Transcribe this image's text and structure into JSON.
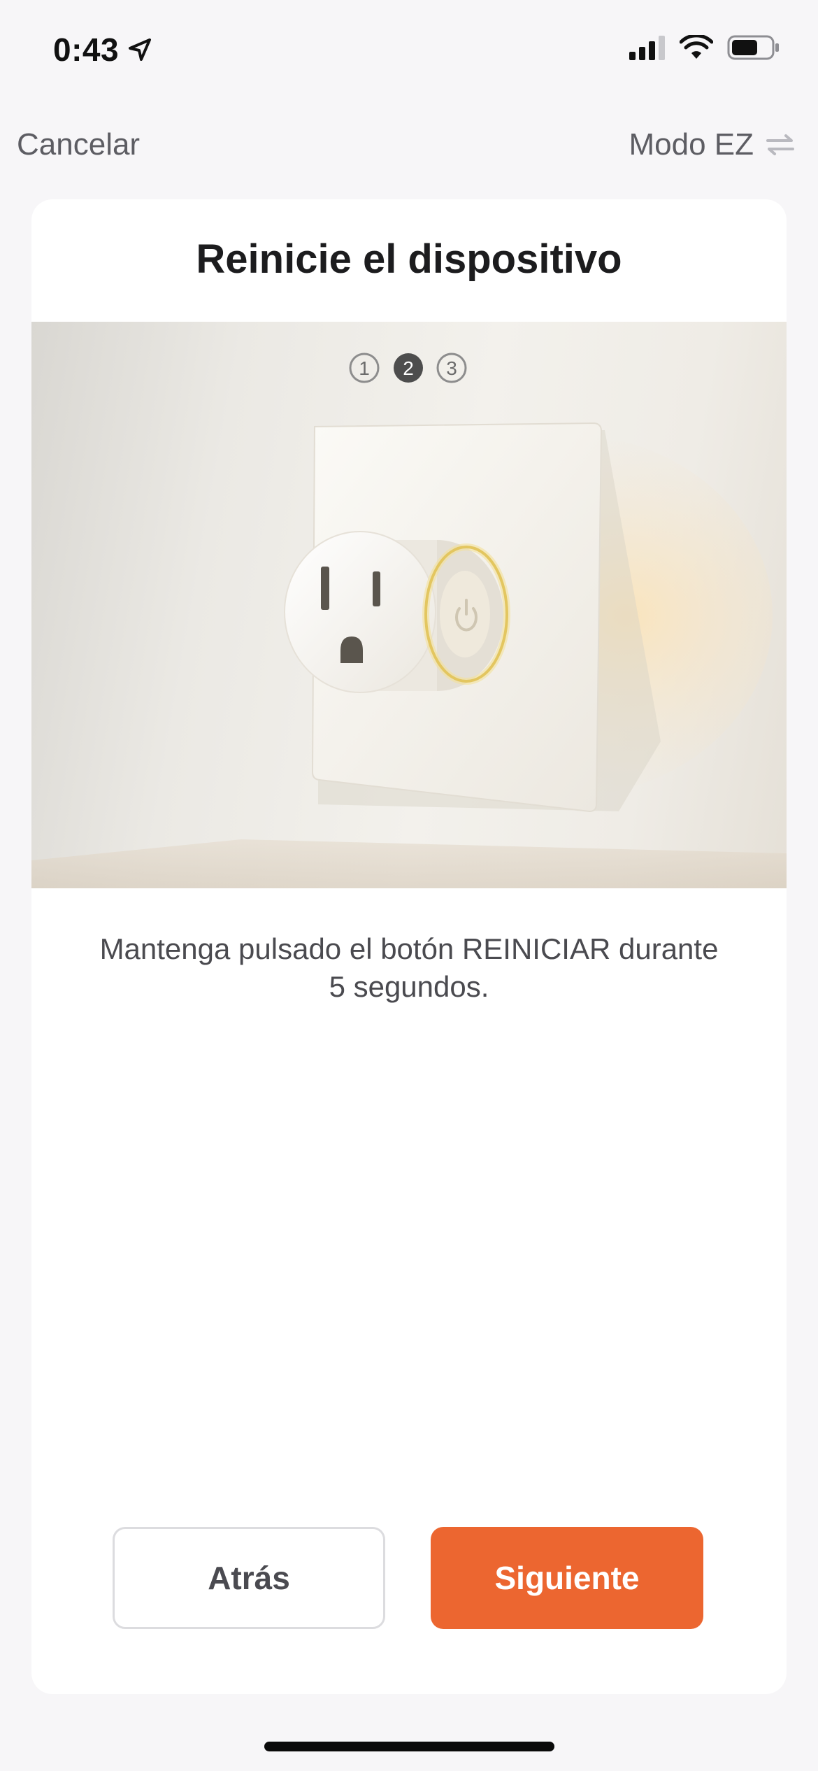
{
  "status_bar": {
    "time": "0:43"
  },
  "nav": {
    "cancel_label": "Cancelar",
    "mode_label": "Modo EZ"
  },
  "card": {
    "title": "Reinicie el dispositivo",
    "steps": [
      "1",
      "2",
      "3"
    ],
    "active_step": 2,
    "instruction": "Mantenga pulsado el botón REINICIAR durante 5 segundos."
  },
  "buttons": {
    "back_label": "Atrás",
    "next_label": "Siguiente"
  },
  "colors": {
    "accent": "#ec6630",
    "background": "#f7f6f8",
    "card": "#ffffff"
  },
  "icons": {
    "location": "location-arrow-icon",
    "signal": "cellular-signal-icon",
    "wifi": "wifi-icon",
    "battery": "battery-icon",
    "swap": "swap-arrows-icon"
  }
}
